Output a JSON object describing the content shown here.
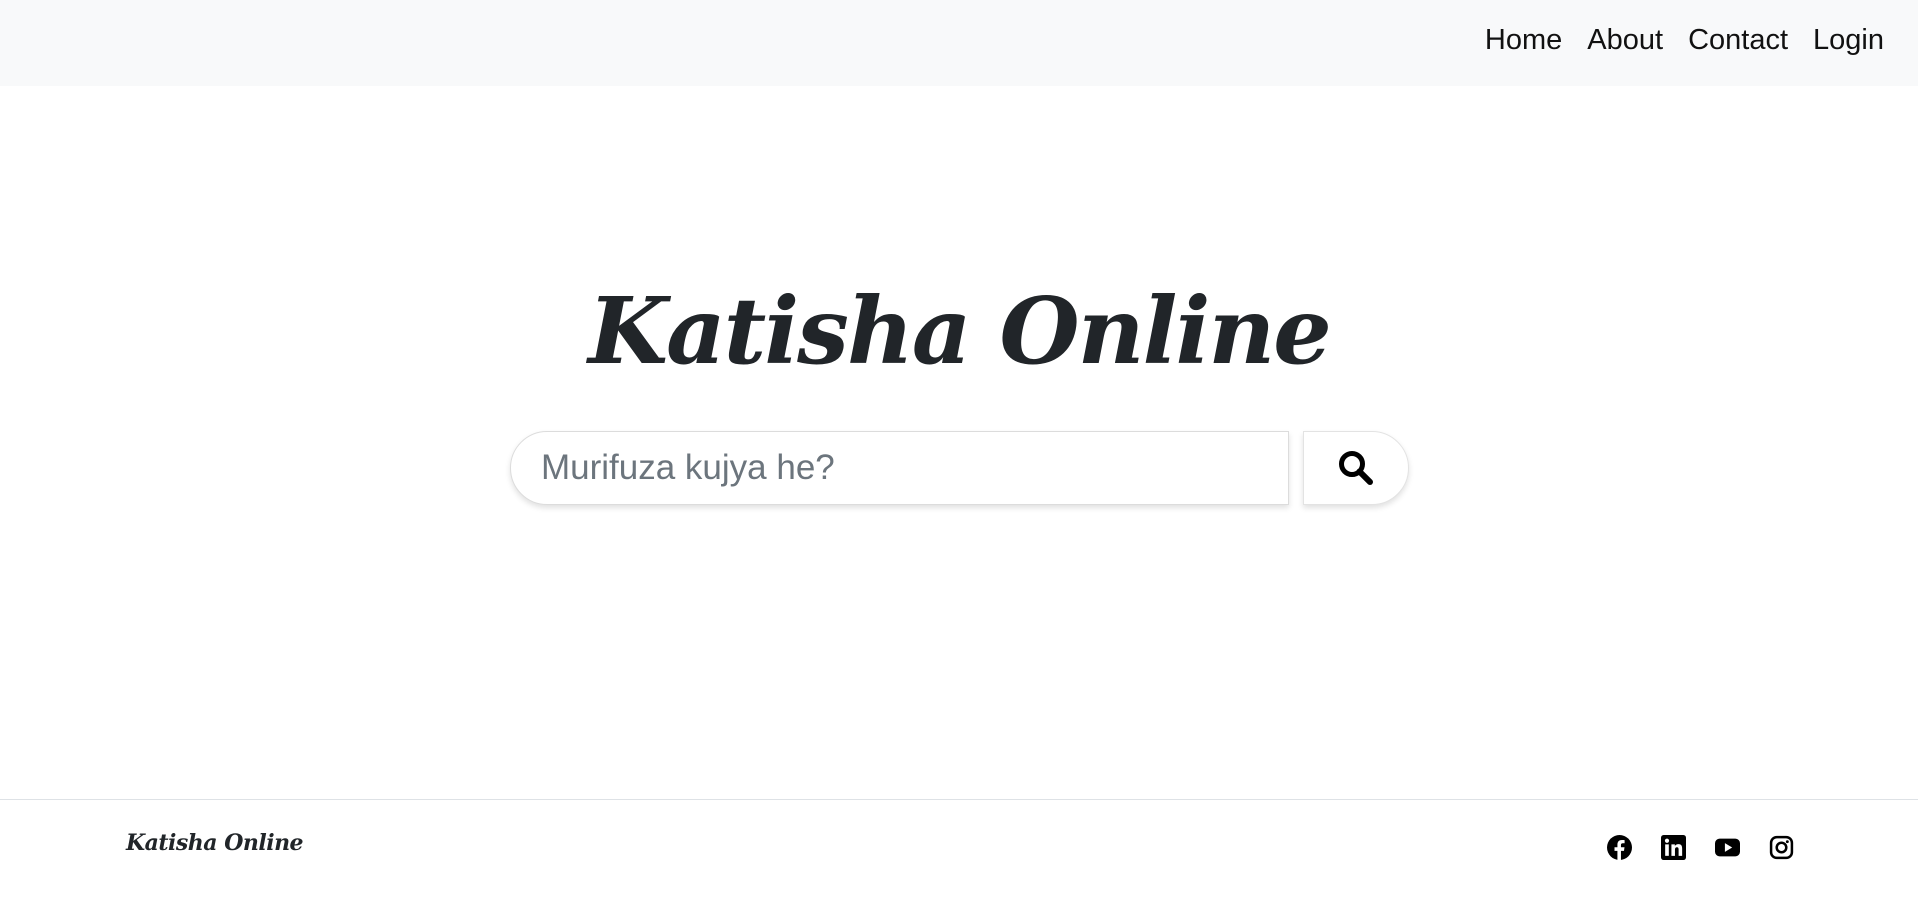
{
  "nav": {
    "links": [
      "Home",
      "About",
      "Contact",
      "Login"
    ]
  },
  "hero": {
    "brand": "Katisha Online"
  },
  "search": {
    "placeholder": "Murifuza kujya he?",
    "button_icon": "search-icon"
  },
  "footer": {
    "brand": "Katisha Online",
    "social_icons": [
      "facebook-icon",
      "linkedin-icon",
      "youtube-icon",
      "instagram-icon"
    ]
  },
  "colors": {
    "navbar_bg": "#f8f9fa",
    "text": "#212529",
    "placeholder": "#6c757d"
  }
}
